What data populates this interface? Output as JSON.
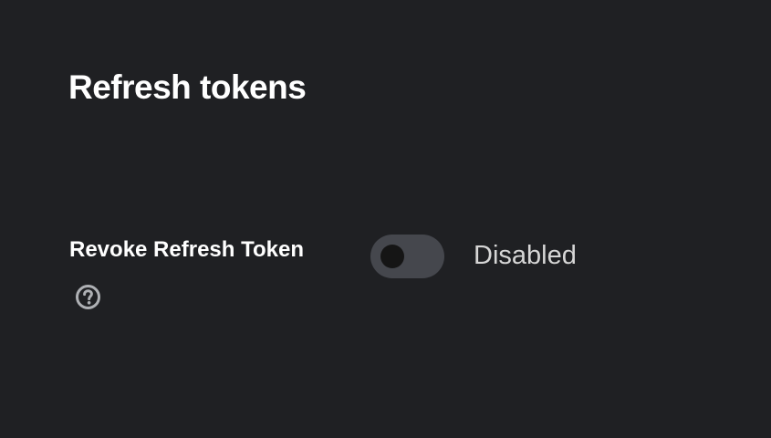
{
  "section": {
    "title": "Refresh tokens"
  },
  "revoke_refresh_token": {
    "label": "Revoke Refresh Token",
    "help_icon": "question-circle-icon",
    "toggle_on": false,
    "status_text": "Disabled"
  },
  "colors": {
    "background": "#1f2023",
    "toggle_track_off": "#45474d",
    "toggle_knob": "#151515",
    "help_icon": "#aeb0b4"
  }
}
